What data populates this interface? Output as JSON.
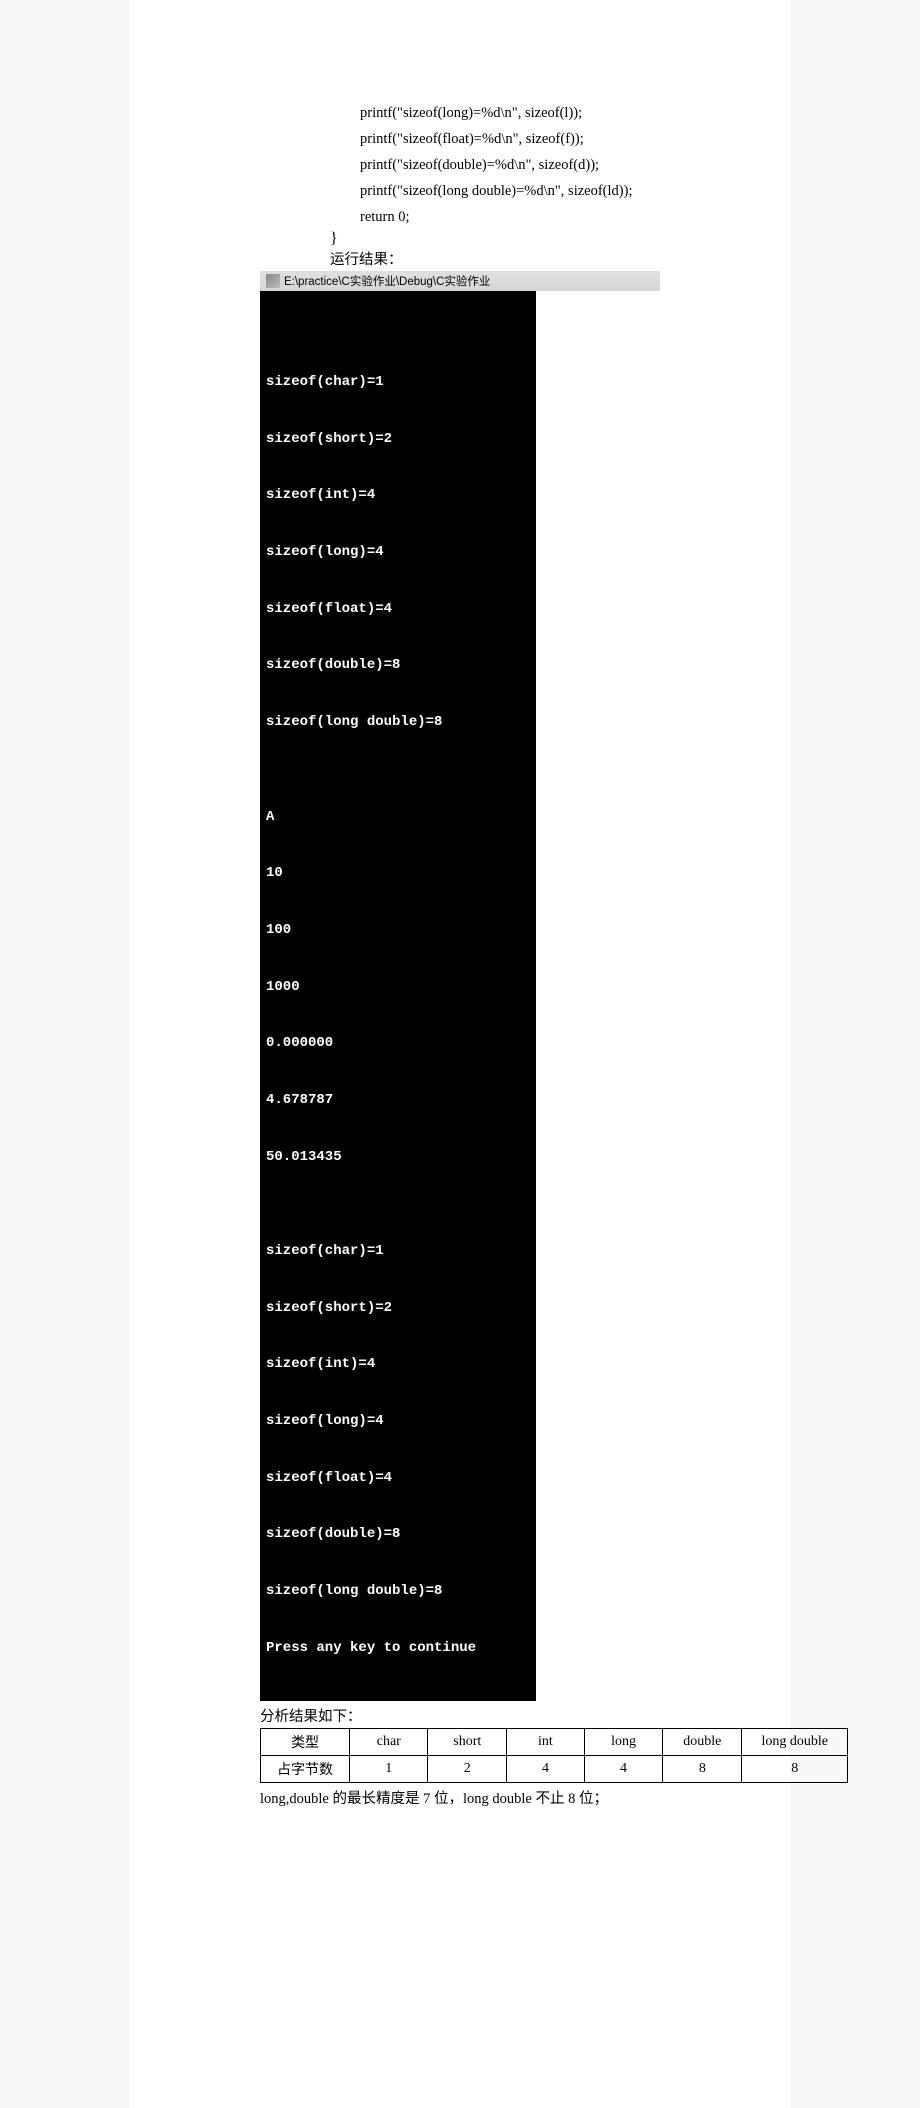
{
  "code": {
    "line1": "printf(\"sizeof(long)=%d\\n\", sizeof(l));",
    "line2": "printf(\"sizeof(float)=%d\\n\", sizeof(f));",
    "line3": "printf(\"sizeof(double)=%d\\n\", sizeof(d));",
    "line4": "printf(\"sizeof(long double)=%d\\n\", sizeof(ld));",
    "blank": "",
    "line5": "return 0;",
    "brace": "}"
  },
  "labels": {
    "run_result": "运行结果：",
    "analysis": "分析结果如下：",
    "conclusion": "long,double 的最长精度是 7 位，long double 不止 8 位；"
  },
  "titlebar": {
    "text": "E:\\practice\\C实验作业\\Debug\\C实验作业"
  },
  "terminal": {
    "lines": [
      "",
      "sizeof(char)=1",
      "sizeof(short)=2",
      "sizeof(int)=4",
      "sizeof(long)=4",
      "sizeof(float)=4",
      "sizeof(double)=8",
      "sizeof(long double)=8",
      "",
      "A",
      "10",
      "100",
      "1000",
      "0.000000",
      "4.678787",
      "50.013435",
      "",
      "sizeof(char)=1",
      "sizeof(short)=2",
      "sizeof(int)=4",
      "sizeof(long)=4",
      "sizeof(float)=4",
      "sizeof(double)=8",
      "sizeof(long double)=8",
      "Press any key to continue"
    ]
  },
  "table": {
    "header": {
      "c1": "类型",
      "c2": "char",
      "c3": "short",
      "c4": "int",
      "c5": "long",
      "c6": "double",
      "c7": "long double"
    },
    "row1": {
      "c1": "占字节数",
      "c2": "1",
      "c3": "2",
      "c4": "4",
      "c5": "4",
      "c6": "8",
      "c7": "8"
    }
  }
}
